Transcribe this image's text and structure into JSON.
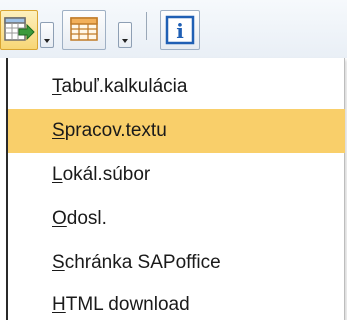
{
  "toolbar": {
    "export_button": {
      "icon": "export-spreadsheet-icon",
      "state": "pressed"
    },
    "layout_button": {
      "icon": "grid-layout-icon",
      "state": "normal"
    },
    "info_button": {
      "icon": "information-icon",
      "glyph": "i",
      "state": "normal"
    }
  },
  "menu": {
    "items": [
      {
        "accel": "T",
        "rest": "abuľ.kalkulácia",
        "active": false
      },
      {
        "accel": "S",
        "rest": "pracov.textu",
        "active": true
      },
      {
        "accel": "L",
        "rest": "okál.súbor",
        "active": false
      },
      {
        "accel": "O",
        "rest": "dosl.",
        "active": false
      },
      {
        "accel": "S",
        "rest": "chránka SAPoffice",
        "active": false
      },
      {
        "accel": "H",
        "rest": "TML download",
        "active": false
      }
    ]
  },
  "colors": {
    "highlight": "#f9cf6a",
    "pressed_button": "#f7d675",
    "icon_blue": "#1f5fb4",
    "icon_green": "#3c9a3c"
  }
}
